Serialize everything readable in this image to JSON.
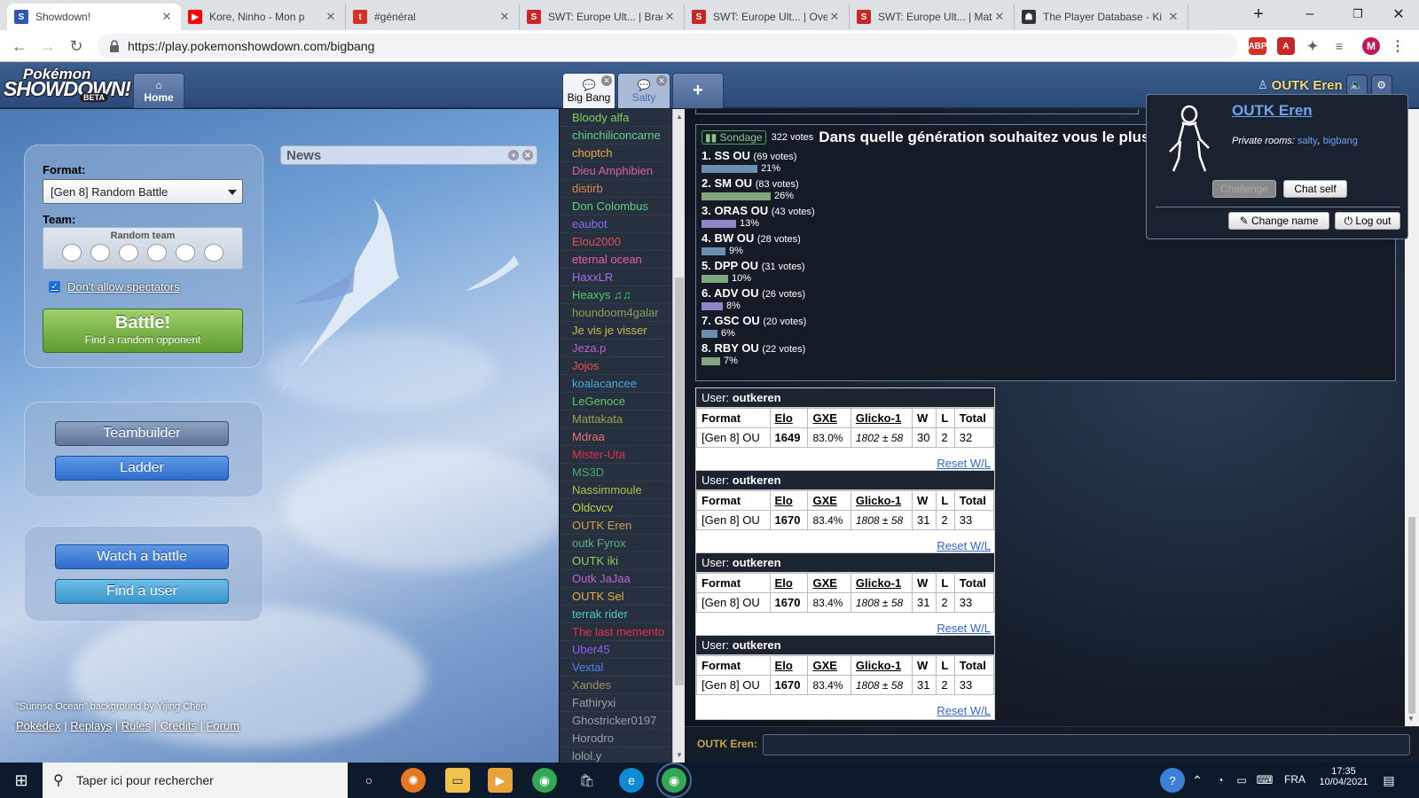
{
  "browser": {
    "tabs": [
      {
        "title": "Showdown!",
        "icon": "showdown-icon",
        "color": "#2a5aa8",
        "glyph": "S",
        "active": true
      },
      {
        "title": "Kore, Ninho - Mon p",
        "icon": "youtube-icon",
        "color": "#ff0000",
        "glyph": "▶",
        "active": false
      },
      {
        "title": "#général",
        "icon": "toornament-icon",
        "color": "#d93025",
        "glyph": "t",
        "active": false
      },
      {
        "title": "SWT: Europe Ult... | Brack",
        "icon": "smogon-icon",
        "color": "#c62828",
        "glyph": "S",
        "active": false
      },
      {
        "title": "SWT: Europe Ult... | Over",
        "icon": "smogon-icon",
        "color": "#c62828",
        "glyph": "S",
        "active": false
      },
      {
        "title": "SWT: Europe Ult... | Matc",
        "icon": "smogon-icon",
        "color": "#c62828",
        "glyph": "S",
        "active": false
      },
      {
        "title": "The Player Database - Ki",
        "icon": "person-icon",
        "color": "#333333",
        "glyph": "☗",
        "active": false
      }
    ],
    "url": "https://play.pokemonshowdown.com/bigbang",
    "profile_initial": "M"
  },
  "header": {
    "logo_line1": "Pokémon",
    "logo_line2": "SHOWDOWN!",
    "logo_beta": "BETA",
    "home_label": "Home",
    "rooms": [
      {
        "label": "Big Bang",
        "active": true
      },
      {
        "label": "Salty",
        "active": false
      }
    ],
    "username": "OUTK Eren"
  },
  "home": {
    "format_label": "Format:",
    "format_value": "[Gen 8] Random Battle",
    "team_label": "Team:",
    "team_value": "Random team",
    "spectators_label": "Don't allow spectators",
    "battle_label": "Battle!",
    "battle_sub": "Find a random opponent",
    "teambuilder_label": "Teambuilder",
    "ladder_label": "Ladder",
    "watch_label": "Watch a battle",
    "find_user_label": "Find a user",
    "news_title": "News",
    "credit": "\"Sunrise Ocean\" background by Yijing Chen",
    "links": [
      "Pokédex",
      "Replays",
      "Rules",
      "Credits",
      "Forum"
    ]
  },
  "userlist": [
    {
      "name": "Bloody alfa",
      "color": "#7fcf5f"
    },
    {
      "name": "chinchiliconcarne",
      "color": "#6ccf8c"
    },
    {
      "name": "choptch",
      "color": "#e8a84a"
    },
    {
      "name": "Dieu Amphibien",
      "color": "#d95fa5"
    },
    {
      "name": "distirb",
      "color": "#e08a4e"
    },
    {
      "name": "Don Colombus",
      "color": "#5fcf82"
    },
    {
      "name": "eaubot",
      "color": "#8c6cf0"
    },
    {
      "name": "Elou2000",
      "color": "#e0505a"
    },
    {
      "name": "eternal ocean",
      "color": "#e85fb0"
    },
    {
      "name": "HaxxLR",
      "color": "#a86ce8"
    },
    {
      "name": "Heaxys ♫♫",
      "color": "#4fcf6c"
    },
    {
      "name": "houndoom4galar",
      "color": "#8ca05a"
    },
    {
      "name": "Je vis je visser",
      "color": "#c9b94a"
    },
    {
      "name": "Jeza.p",
      "color": "#c05fd0"
    },
    {
      "name": "Jojos",
      "color": "#f0504a"
    },
    {
      "name": "koalacancee",
      "color": "#4aa8e0"
    },
    {
      "name": "LeGenoce",
      "color": "#5fc85f"
    },
    {
      "name": "Mattakata",
      "color": "#a0a04a"
    },
    {
      "name": "Mdraa",
      "color": "#e87070"
    },
    {
      "name": "Mister-Uta",
      "color": "#e0304a"
    },
    {
      "name": "MS3D",
      "color": "#4aa870"
    },
    {
      "name": "Nassimmoule",
      "color": "#b0c04a"
    },
    {
      "name": "Oldcvcv",
      "color": "#c0d04a"
    },
    {
      "name": "OUTK Eren",
      "color": "#d0a04a"
    },
    {
      "name": "outk Fyrox",
      "color": "#5fb07f"
    },
    {
      "name": "OUTK iki",
      "color": "#8cd05f"
    },
    {
      "name": "Outk JaJaa",
      "color": "#c05fe0"
    },
    {
      "name": "OUTK Sel",
      "color": "#e0b040"
    },
    {
      "name": "terrak rider",
      "color": "#4fd0b0"
    },
    {
      "name": "The last memento",
      "color": "#e8304a"
    },
    {
      "name": "Uber45",
      "color": "#9060f0"
    },
    {
      "name": "Vextal",
      "color": "#4f80f0"
    },
    {
      "name": "Xandes",
      "color": "#a09060"
    },
    {
      "name": "Fathiryxi",
      "color": "#9aa0a8"
    },
    {
      "name": "Ghostricker0197",
      "color": "#9aa0a8"
    },
    {
      "name": "Horodro",
      "color": "#9aa0a8"
    },
    {
      "name": "lolol.y",
      "color": "#9aa0a8"
    }
  ],
  "poll": {
    "tag": "Sondage",
    "votes": "322 votes",
    "question": "Dans quelle génération souhaitez vous le plus",
    "options": [
      {
        "label": "1. SS OU",
        "votes": "(69 votes)",
        "pct": "21%",
        "value": 21,
        "color": "#6c8fb0"
      },
      {
        "label": "2. SM OU",
        "votes": "(83 votes)",
        "pct": "26%",
        "value": 26,
        "color": "#7fa87f"
      },
      {
        "label": "3. ORAS OU",
        "votes": "(43 votes)",
        "pct": "13%",
        "value": 13,
        "color": "#8f86c8"
      },
      {
        "label": "4. BW OU",
        "votes": "(28 votes)",
        "pct": "9%",
        "value": 9,
        "color": "#6c8fb0"
      },
      {
        "label": "5. DPP OU",
        "votes": "(31 votes)",
        "pct": "10%",
        "value": 10,
        "color": "#7fa87f"
      },
      {
        "label": "6. ADV OU",
        "votes": "(26 votes)",
        "pct": "8%",
        "value": 8,
        "color": "#8f86c8"
      },
      {
        "label": "7. GSC OU",
        "votes": "(20 votes)",
        "pct": "6%",
        "value": 6,
        "color": "#6c8fb0"
      },
      {
        "label": "8. RBY OU",
        "votes": "(22 votes)",
        "pct": "7%",
        "value": 7,
        "color": "#7fa87f"
      }
    ]
  },
  "stats": {
    "user_prefix": "User:",
    "headers": [
      "Format",
      "Elo",
      "GXE",
      "Glicko-1",
      "W",
      "L",
      "Total"
    ],
    "reset_label": "Reset W/L",
    "boxes": [
      {
        "user": "outkeren",
        "row": [
          "[Gen 8] OU",
          "1649",
          "83.0%",
          "1802 ± 58",
          "30",
          "2",
          "32"
        ]
      },
      {
        "user": "outkeren",
        "row": [
          "[Gen 8] OU",
          "1670",
          "83.4%",
          "1808 ± 58",
          "31",
          "2",
          "33"
        ]
      },
      {
        "user": "outkeren",
        "row": [
          "[Gen 8] OU",
          "1670",
          "83.4%",
          "1808 ± 58",
          "31",
          "2",
          "33"
        ]
      },
      {
        "user": "outkeren",
        "row": [
          "[Gen 8] OU",
          "1670",
          "83.4%",
          "1808 ± 58",
          "31",
          "2",
          "33"
        ]
      }
    ]
  },
  "chat_input_label": "OUTK Eren:",
  "popup": {
    "name": "OUTK Eren",
    "rooms_label": "Private rooms:",
    "room1": "salty",
    "room2": "bigbang",
    "challenge": "Challenge",
    "chat_self": "Chat self",
    "change_name": "Change name",
    "log_out": "Log out"
  },
  "taskbar": {
    "search_placeholder": "Taper ici pour rechercher",
    "lang": "FRA",
    "time": "17:35",
    "date": "10/04/2021"
  }
}
